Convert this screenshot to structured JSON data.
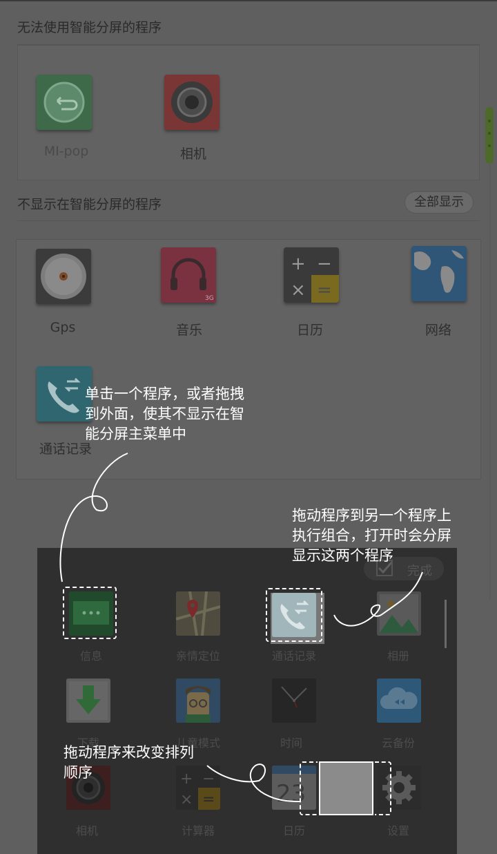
{
  "sections": {
    "disabled_title": "无法使用智能分屏的程序",
    "hidden_title": "不显示在智能分屏的程序",
    "show_all_label": "全部显示"
  },
  "disabled_apps": [
    {
      "label": "MI-pop",
      "icon": "mi-pop-icon"
    },
    {
      "label": "相机",
      "icon": "camera-icon"
    }
  ],
  "hidden_apps": [
    {
      "label": "Gps",
      "icon": "gps-disc-icon"
    },
    {
      "label": "音乐",
      "icon": "headphones-icon"
    },
    {
      "label": "日历",
      "icon": "calculator-icon"
    },
    {
      "label": "网络",
      "icon": "globe-map-icon"
    },
    {
      "label": "通话记录",
      "icon": "call-log-icon"
    }
  ],
  "drawer": {
    "done_label": "完成",
    "apps": [
      {
        "label": "信息",
        "icon": "message-icon"
      },
      {
        "label": "亲情定位",
        "icon": "map-pin-icon"
      },
      {
        "label": "通话记录",
        "icon": "call-log-icon"
      },
      {
        "label": "相册",
        "icon": "gallery-icon"
      },
      {
        "label": "下载",
        "icon": "download-icon"
      },
      {
        "label": "儿童模式",
        "icon": "kid-face-icon"
      },
      {
        "label": "时间",
        "icon": "clock-icon"
      },
      {
        "label": "云备份",
        "icon": "cloud-backup-icon"
      },
      {
        "label": "相机",
        "icon": "camera-icon"
      },
      {
        "label": "计算器",
        "icon": "calculator-icon"
      },
      {
        "label": "日历",
        "icon": "calendar-icon"
      },
      {
        "label": "设置",
        "icon": "gear-icon"
      }
    ]
  },
  "annotations": {
    "tap_hint": [
      "单击一个程序，或者拖拽",
      "到外面，使其不显示在智",
      "能分屏主菜单中"
    ],
    "combine_hint": [
      "拖动程序到另一个程序上",
      "执行组合，打开时会分屏",
      "显示这两个程序"
    ],
    "reorder_hint": [
      "拖动程序来改变排列",
      "顺序"
    ]
  },
  "colors": {
    "overlay": "#5f5f5f",
    "drawer_bg": "#2f2f2f",
    "annotation": "#ffffff",
    "scroll_accent": "#4e6a2a"
  }
}
